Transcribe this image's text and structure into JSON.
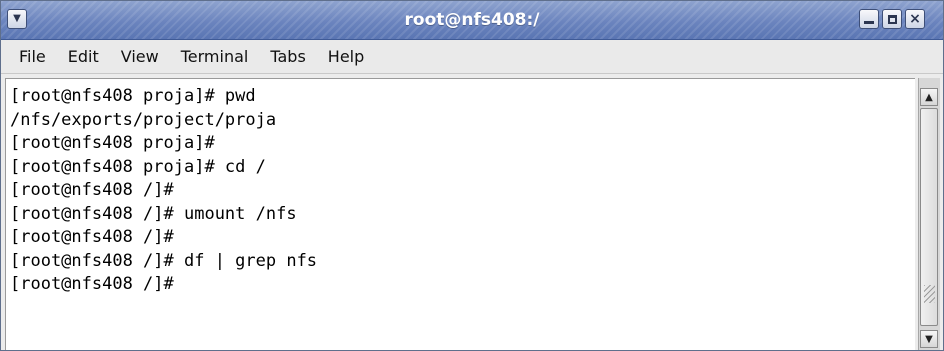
{
  "window": {
    "title": "root@nfs408:/"
  },
  "titlebar": {
    "menu_icon": "chevron-down-icon",
    "minimize_icon": "minimize-icon",
    "maximize_icon": "maximize-icon",
    "close_icon": "close-icon"
  },
  "menubar": {
    "items": [
      {
        "label": "File"
      },
      {
        "label": "Edit"
      },
      {
        "label": "View"
      },
      {
        "label": "Terminal"
      },
      {
        "label": "Tabs"
      },
      {
        "label": "Help"
      }
    ]
  },
  "terminal": {
    "lines": [
      "[root@nfs408 proja]# pwd",
      "/nfs/exports/project/proja",
      "[root@nfs408 proja]#",
      "[root@nfs408 proja]# cd /",
      "[root@nfs408 /]#",
      "[root@nfs408 /]# umount /nfs",
      "[root@nfs408 /]#",
      "[root@nfs408 /]# df | grep nfs",
      "[root@nfs408 /]#"
    ]
  },
  "scrollbar": {
    "up_icon": "arrow-up-icon",
    "down_icon": "arrow-down-icon"
  },
  "colors": {
    "titlebar": "#6b84be",
    "terminal_bg": "#ffffff",
    "text": "#000000"
  }
}
